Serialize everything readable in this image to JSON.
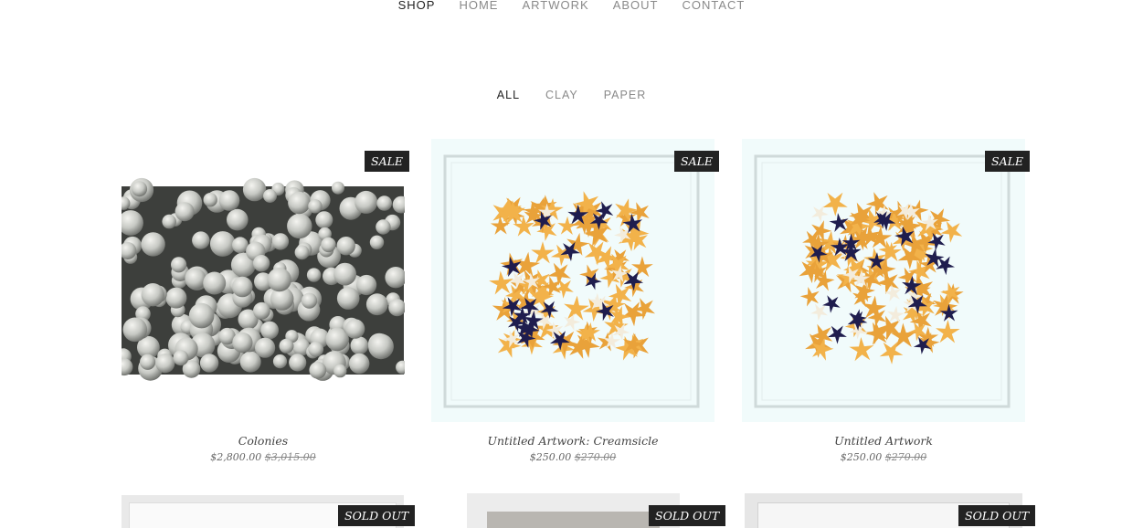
{
  "nav": {
    "items": [
      {
        "label": "SHOP",
        "active": true
      },
      {
        "label": "HOME",
        "active": false
      },
      {
        "label": "ARTWORK",
        "active": false
      },
      {
        "label": "ABOUT",
        "active": false
      },
      {
        "label": "CONTACT",
        "active": false
      }
    ]
  },
  "filters": {
    "items": [
      {
        "label": "ALL",
        "active": true
      },
      {
        "label": "CLAY",
        "active": false
      },
      {
        "label": "PAPER",
        "active": false
      }
    ]
  },
  "products": [
    {
      "title": "Colonies",
      "price": "$2,800.00",
      "old_price": "$3,015.00",
      "badge": "SALE",
      "image": "grey clay spheres"
    },
    {
      "title": "Untitled Artwork: Creamsicle",
      "price": "$250.00",
      "old_price": "$270.00",
      "badge": "SALE",
      "image": "framed orange paper flowers"
    },
    {
      "title": "Untitled Artwork",
      "price": "$250.00",
      "old_price": "$270.00",
      "badge": "SALE",
      "image": "framed orange paper flowers"
    }
  ],
  "row2_badges": [
    "SOLD OUT",
    "SOLD OUT",
    "SOLD OUT"
  ],
  "colors": {
    "badge_bg": "#222222",
    "frame_bg": "#f1fbfb",
    "flower_orange": "#f2b24a",
    "flower_navy": "#1f1d4e"
  }
}
